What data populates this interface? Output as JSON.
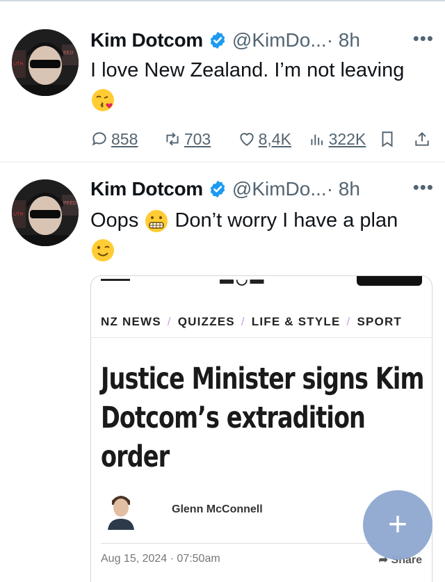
{
  "tweets": [
    {
      "author_name": "Kim Dotcom",
      "handle": "@KimDo...",
      "time": "· 8h",
      "more": "•••",
      "text": "I love New Zealand. I’m not leaving",
      "emoji": "face-blowing-a-kiss",
      "actions": {
        "replies": "858",
        "reposts": "703",
        "likes": "8,4K",
        "views": "322K"
      }
    },
    {
      "author_name": "Kim Dotcom",
      "handle": "@KimDo...",
      "time": "· 8h",
      "more": "•••",
      "text_part1": "Oops",
      "emoji_1": "grimacing-face",
      "text_part2": "Don’t worry I have a plan",
      "emoji_2": "winking-face",
      "card": {
        "nav": [
          "NZ NEWS",
          "QUIZZES",
          "LIFE & STYLE",
          "SPORT"
        ],
        "headline": "Justice Minister signs Kim Dotcom’s extradition order",
        "author": "Glenn McConnell",
        "date": "Aug 15, 2024 · 07:50am",
        "share": "Share"
      }
    }
  ],
  "fab": {
    "label": "+"
  },
  "colors": {
    "verified": "#1d9bf0",
    "muted_text": "#536471",
    "fab": "#8fa8d0",
    "nav_separator": "#c9a0e0"
  }
}
